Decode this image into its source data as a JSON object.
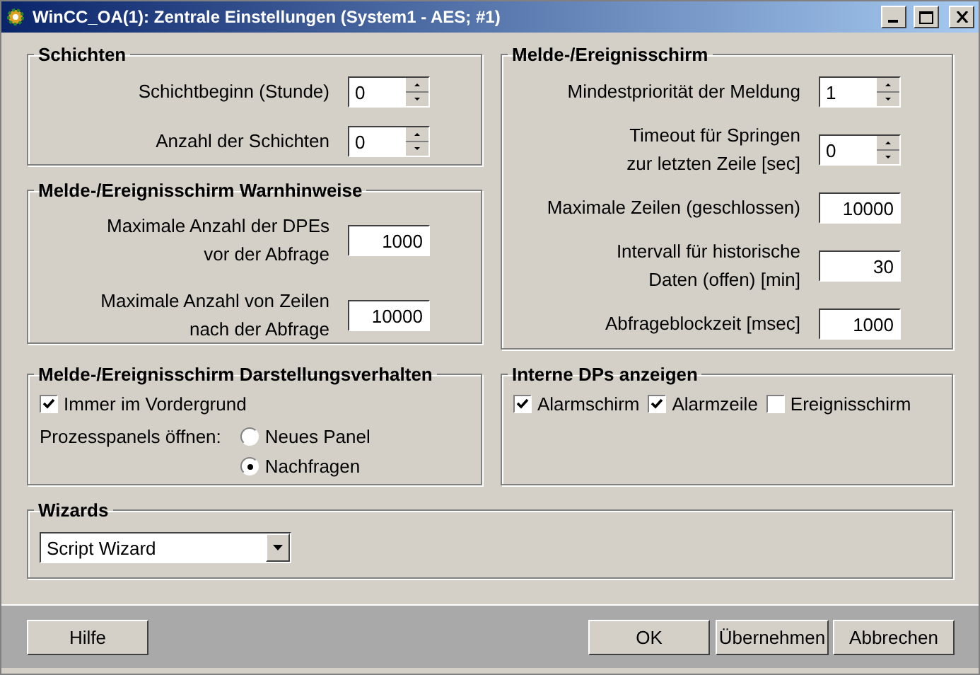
{
  "window": {
    "title": "WinCC_OA(1): Zentrale Einstellungen (System1 - AES; #1)"
  },
  "left_groups": [
    {
      "title": "Schichten",
      "fields": [
        {
          "kind": "spin",
          "label": "Schichtbeginn (Stunde)",
          "value": "0"
        },
        {
          "kind": "spin",
          "label": "Anzahl der Schichten",
          "value": "0"
        }
      ]
    },
    {
      "title": "Melde-/Ereignisschirm Warnhinweise",
      "fields": [
        {
          "kind": "text",
          "label": "Maximale Anzahl der DPEs\nvor der Abfrage",
          "value": "1000"
        },
        {
          "kind": "text",
          "label": "Maximale Anzahl von Zeilen\nnach der Abfrage",
          "value": "10000"
        }
      ]
    }
  ],
  "right_groups": [
    {
      "title": "Melde-/Ereignisschirm",
      "fields": [
        {
          "kind": "spin",
          "label": "Mindestpriorität der Meldung",
          "value": "1"
        },
        {
          "kind": "spin",
          "label": "Timeout für Springen\nzur letzten Zeile [sec]",
          "value": "0"
        },
        {
          "kind": "text",
          "label": "Maximale Zeilen (geschlossen)",
          "value": "10000"
        },
        {
          "kind": "text",
          "label": "Intervall für historische\nDaten (offen) [min]",
          "value": "30"
        },
        {
          "kind": "text",
          "label": "Abfrageblockzeit [msec]",
          "value": "1000"
        }
      ]
    }
  ],
  "display_behavior": {
    "title": "Melde-/Ereignisschirm Darstellungsverhalten",
    "always_on_top": {
      "label": "Immer im Vordergrund",
      "checked": true
    },
    "open_label": "Prozesspanels öffnen:",
    "options": [
      {
        "label": "Neues Panel",
        "selected": false
      },
      {
        "label": "Nachfragen",
        "selected": true
      }
    ]
  },
  "internal_dps": {
    "title": "Interne DPs anzeigen",
    "items": [
      {
        "label": "Alarmschirm",
        "checked": true
      },
      {
        "label": "Alarmzeile",
        "checked": true
      },
      {
        "label": "Ereignisschirm",
        "checked": false
      }
    ]
  },
  "wizards": {
    "title": "Wizards",
    "value": "Script Wizard"
  },
  "buttons_left": [
    "Hilfe"
  ],
  "buttons_right": [
    "OK",
    "Übernehmen",
    "Abbrechen"
  ]
}
